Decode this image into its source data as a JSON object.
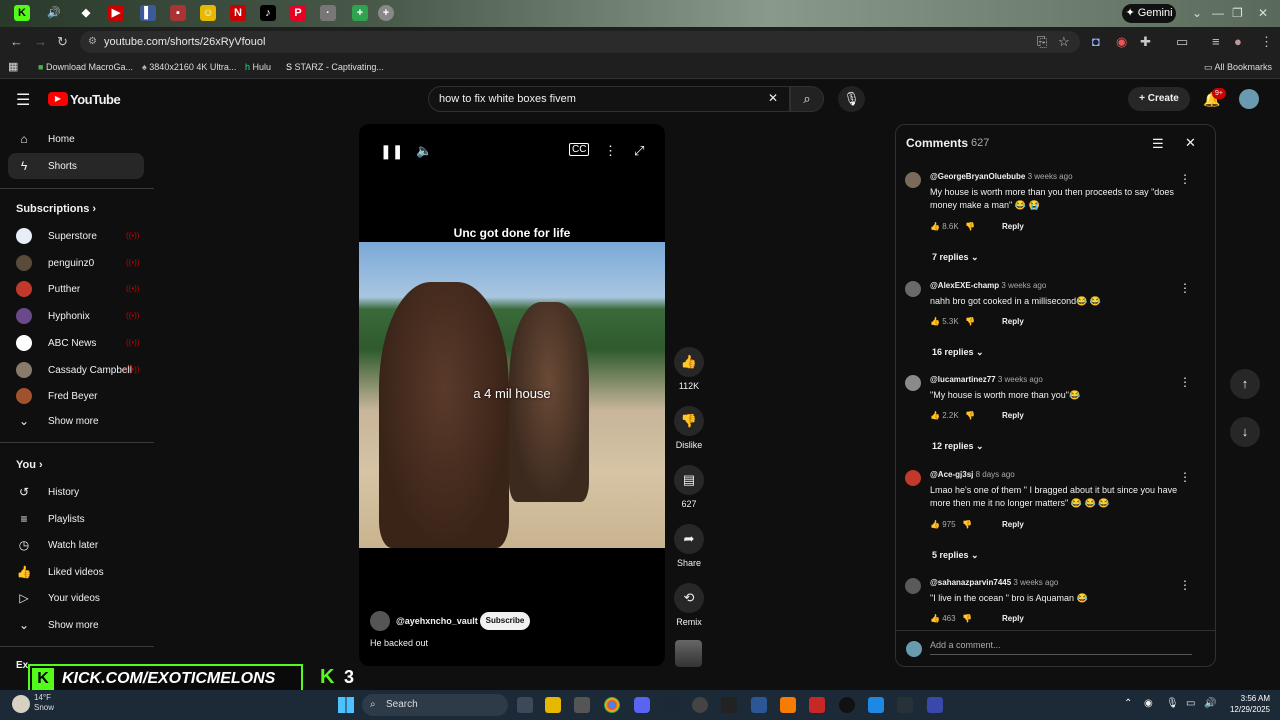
{
  "browser": {
    "gemini_label": "Gemini",
    "url": "youtube.com/shorts/26xRyVfouol",
    "bookmarks": [
      "Download MacroGa...",
      "3840x2160 4K Ultra...",
      "Hulu",
      "STARZ - Captivating..."
    ],
    "all_bookmarks": "All Bookmarks"
  },
  "header": {
    "logo": "YouTube",
    "search_value": "how to fix white boxes fivem",
    "create_label": "Create",
    "notif_badge": "9+"
  },
  "sidebar": {
    "home": "Home",
    "shorts": "Shorts",
    "subscriptions_title": "Subscriptions",
    "subscriptions": [
      {
        "name": "Superstore",
        "color": "#e8eef8"
      },
      {
        "name": "penguinz0",
        "color": "#5a4a3a"
      },
      {
        "name": "Putther",
        "color": "#c0392b"
      },
      {
        "name": "Hyphonix",
        "color": "#6a4a8a"
      },
      {
        "name": "ABC News",
        "color": "#ffffff"
      },
      {
        "name": "Cassady Campbell",
        "color": "#8a7a6a"
      },
      {
        "name": "Fred Beyer",
        "color": "#a0522d"
      }
    ],
    "show_more": "Show more",
    "you_title": "You",
    "you_items": [
      "History",
      "Playlists",
      "Watch later",
      "Liked videos",
      "Your videos"
    ],
    "show_more_2": "Show more",
    "explore_partial": "Ex"
  },
  "short": {
    "caption": "Unc got done for life",
    "overlay": "a 4 mil house",
    "channel": "@ayehxncho_vault",
    "subscribe": "Subscribe",
    "description": "He backed out",
    "actions": {
      "likes": "112K",
      "dislike": "Dislike",
      "comments": "627",
      "share": "Share",
      "remix": "Remix"
    }
  },
  "comments": {
    "title": "Comments",
    "count": "627",
    "reply_label": "Reply",
    "add_placeholder": "Add a comment...",
    "items": [
      {
        "author": "@GeorgeBryanOluebube",
        "when": "3 weeks ago",
        "text": "My house is worth more than you then proceeds to say \"does money make a man\" 😂 😭",
        "likes": "8.6K",
        "replies": "7 replies",
        "color": "#7a6a5a"
      },
      {
        "author": "@AlexEXE-champ",
        "when": "3 weeks ago",
        "text": "nahh bro got cooked in a millisecond😂 😂",
        "likes": "5.3K",
        "replies": "16 replies",
        "color": "#6a6a6a"
      },
      {
        "author": "@lucamartinez77",
        "when": "3 weeks ago",
        "text": "\"My house is worth more than you\"😂",
        "likes": "2.2K",
        "replies": "12 replies",
        "color": "#8a8a8a"
      },
      {
        "author": "@Ace-gj3sj",
        "when": "8 days ago",
        "text": "Lmao he's one of them \" I bragged about it but since you have more then me it no longer matters\" 😂 😂 😂",
        "likes": "975",
        "replies": "5 replies",
        "color": "#c0392b"
      },
      {
        "author": "@sahanazparvin7445",
        "when": "3 weeks ago",
        "text": "\"I live in the ocean \" bro is Aquaman 😂",
        "likes": "463",
        "replies": "",
        "color": "#5a5a5a"
      }
    ]
  },
  "stream_overlay": {
    "banner": "KICK.COM/EXOTICMELONS",
    "k": "K",
    "num": "3"
  },
  "taskbar": {
    "search": "Search",
    "temp": "14°F",
    "weather": "Snow",
    "time": "3:56 AM",
    "date": "12/29/2025"
  }
}
